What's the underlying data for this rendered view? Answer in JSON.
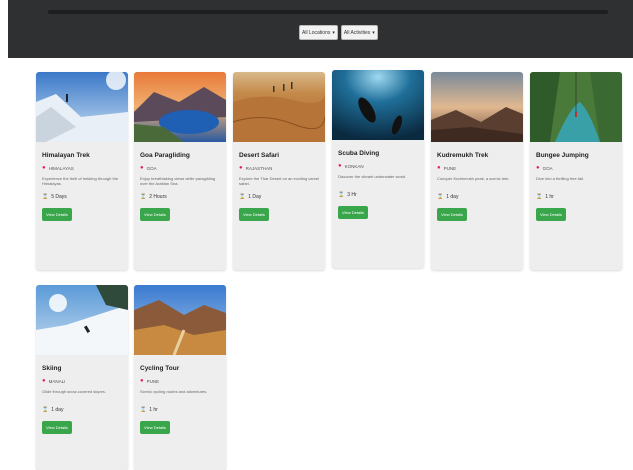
{
  "filters": [
    {
      "label": "All Locations"
    },
    {
      "label": "All Activities"
    }
  ],
  "cards": [
    {
      "title": "Himalayan Trek",
      "location": "HIMALAYAS",
      "description": "Experience the thrill of trekking through the Himalayas.",
      "duration": "5 Days",
      "button": "View Details"
    },
    {
      "title": "Goa Paragliding",
      "location": "GOA",
      "description": "Enjoy breathtaking views while paragliding over the Arabian Sea.",
      "duration": "2 Hours",
      "button": "View Details"
    },
    {
      "title": "Desert Safari",
      "location": "RAJASTHAN",
      "description": "Explore the Thar Desert on an exciting camel safari.",
      "duration": "1 Day",
      "button": "View Details"
    },
    {
      "title": "Scuba Diving",
      "location": "KONKAN",
      "description": "Discover the vibrant underwater world.",
      "duration": "3 Hr",
      "button": "View Details"
    },
    {
      "title": "Kudremukh Trek",
      "location": "PUNE",
      "description": "Conquer Kudremukh peak, a scenic trek.",
      "duration": "1 day",
      "button": "View Details"
    },
    {
      "title": "Bungee Jumping",
      "location": "GOA",
      "description": "Dive into a thrilling free fall.",
      "duration": "1 hr",
      "button": "View Details"
    },
    {
      "title": "Skiing",
      "location": "MANALI",
      "description": "Glide through snow-covered slopes.",
      "duration": "1 day",
      "button": "View Details"
    },
    {
      "title": "Cycling Tour",
      "location": "PUNE",
      "description": "Scenic cycling routes and adventures.",
      "duration": "1 hr",
      "button": "View Details"
    }
  ]
}
